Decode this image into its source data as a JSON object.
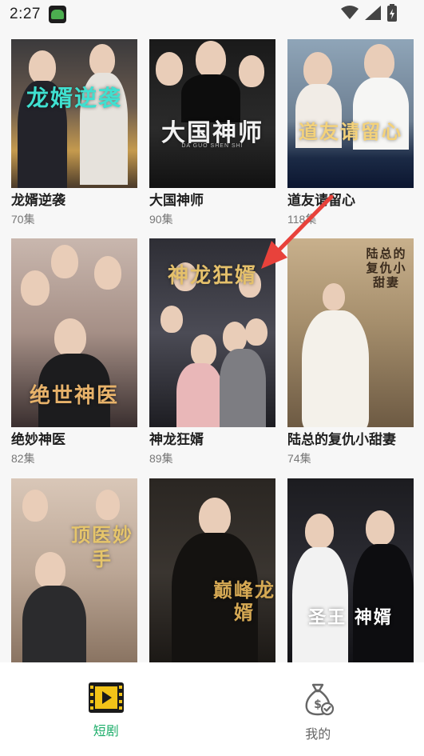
{
  "status_bar": {
    "time": "2:27"
  },
  "dramas": [
    {
      "title": "龙婿逆袭",
      "episodes": "70集",
      "poster_text": "龙婿逆袭"
    },
    {
      "title": "大国神师",
      "episodes": "90集",
      "poster_text": "大国神师",
      "poster_subtext": "DA GUO SHEN SHI"
    },
    {
      "title": "道友请留心",
      "episodes": "118集",
      "poster_text": "道友请留心"
    },
    {
      "title": "绝妙神医",
      "episodes": "82集",
      "poster_text": "绝世神医"
    },
    {
      "title": "神龙狂婿",
      "episodes": "89集",
      "poster_text": "神龙狂婿"
    },
    {
      "title": "陆总的复仇小甜妻",
      "episodes": "74集",
      "poster_text": "陆总的复仇小甜妻"
    },
    {
      "title": "",
      "episodes": "",
      "poster_text": "顶医妙手"
    },
    {
      "title": "",
      "episodes": "",
      "poster_text": "巅峰龙婿"
    },
    {
      "title": "",
      "episodes": "",
      "poster_text": "圣王 神婿"
    }
  ],
  "bottom_nav": {
    "tabs": [
      {
        "label": "短剧",
        "icon": "film-icon",
        "active": true
      },
      {
        "label": "我的",
        "icon": "money-bag-icon",
        "active": false
      }
    ]
  },
  "colors": {
    "accent": "#1eae6b",
    "annotation_arrow": "#e8423b"
  }
}
